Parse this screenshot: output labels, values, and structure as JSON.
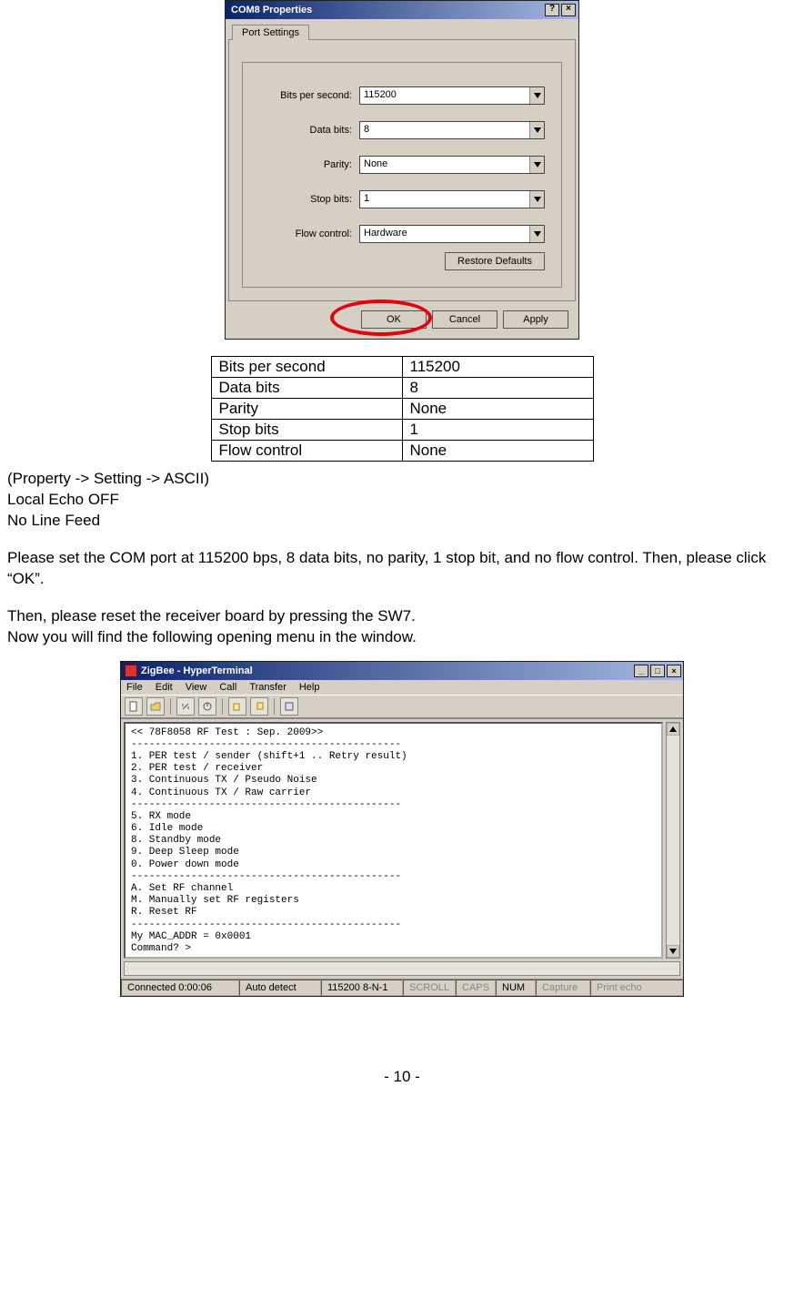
{
  "dialog1": {
    "title": "COM8 Properties",
    "help_glyph": "?",
    "close_glyph": "×",
    "tab_label": "Port Settings",
    "fields": {
      "bps_label": "Bits per second:",
      "bps_value": "115200",
      "databits_label": "Data bits:",
      "databits_value": "8",
      "parity_label": "Parity:",
      "parity_value": "None",
      "stopbits_label": "Stop bits:",
      "stopbits_value": "1",
      "flow_label": "Flow control:",
      "flow_value": "Hardware"
    },
    "restore_btn": "Restore Defaults",
    "ok_btn": "OK",
    "cancel_btn": "Cancel",
    "apply_btn": "Apply"
  },
  "settings_table": {
    "r1_k": "Bits per second",
    "r1_v": "115200",
    "r2_k": "Data bits",
    "r2_v": "8",
    "r3_k": "Parity",
    "r3_v": "None",
    "r4_k": "Stop bits",
    "r4_v": "1",
    "r5_k": "Flow control",
    "r5_v": "None"
  },
  "doc": {
    "line1": "(Property -> Setting -> ASCII)",
    "line2": "Local Echo OFF",
    "line3": "No Line Feed",
    "para1": "Please set the COM port at 115200 bps, 8 data bits, no parity, 1 stop bit, and no flow control. Then, please click “OK”.",
    "para2a": "Then, please reset the receiver board by pressing the SW7.",
    "para2b": "Now you will find the following opening menu in the window."
  },
  "ht": {
    "title": "ZigBee - HyperTerminal",
    "menu": [
      "File",
      "Edit",
      "View",
      "Call",
      "Transfer",
      "Help"
    ],
    "min_glyph": "_",
    "max_glyph": "□",
    "close_glyph": "×",
    "terminal_text": "<< 78F8058 RF Test : Sep. 2009>>\n---------------------------------------------\n1. PER test / sender (shift+1 .. Retry result)\n2. PER test / receiver\n3. Continuous TX / Pseudo Noise\n4. Continuous TX / Raw carrier\n---------------------------------------------\n5. RX mode\n6. Idle mode\n8. Standby mode\n9. Deep Sleep mode\n0. Power down mode\n---------------------------------------------\nA. Set RF channel\nM. Manually set RF registers\nR. Reset RF\n---------------------------------------------\nMy MAC_ADDR = 0x0001\nCommand? >",
    "status": {
      "conn": "Connected 0:00:06",
      "detect": "Auto detect",
      "cfg": "115200 8-N-1",
      "scroll": "SCROLL",
      "caps": "CAPS",
      "num": "NUM",
      "capture": "Capture",
      "echo": "Print echo"
    }
  },
  "page_num": "- 10 -"
}
